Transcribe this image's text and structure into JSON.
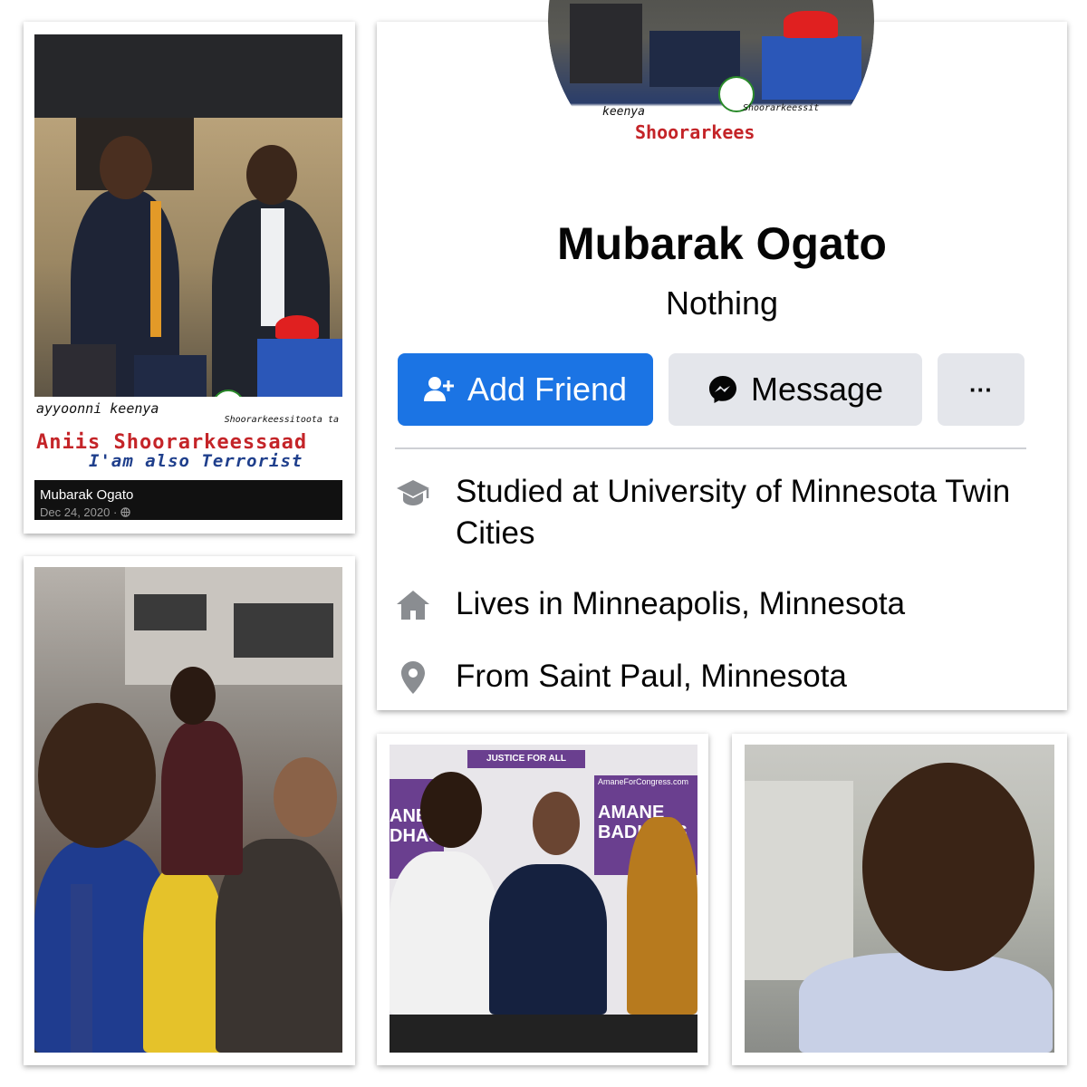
{
  "post": {
    "author_name": "Mubarak Ogato",
    "date": "Dec 24, 2020",
    "visibility_separator": "·",
    "visibility_icon": "globe-icon",
    "banner_line1": "ayyoonni keenya",
    "banner_line1_small": "Shoorarkeessitoota ta",
    "banner_line2": "Aniis Shoorarkeessaad",
    "banner_line3": "I'am also Terrorist"
  },
  "profile": {
    "avatar_text_small": "keenya",
    "avatar_text_small2": "Shoorarkeessit",
    "avatar_text_large": "Shoorarkees",
    "name": "Mubarak Ogato",
    "bio": "Nothing",
    "buttons": {
      "add_friend": "Add Friend",
      "message": "Message",
      "more": "···"
    },
    "info": {
      "studied_prefix": "Studied at ",
      "studied_place": "University of Minnesota Twin Cities",
      "lives_prefix": "Lives in ",
      "lives_place": "Minneapolis, Minnesota",
      "from_prefix": "From ",
      "from_place": "Saint Paul, Minnesota"
    }
  },
  "campaign": {
    "justice_sign": "JUSTICE FOR ALL",
    "site_small": "AmaneForCongress.com",
    "left_sign": "ANE DHAS",
    "right_sign_line1": "AMANE",
    "right_sign_line2": "BADHASS"
  },
  "colors": {
    "facebook_blue": "#1b74e4",
    "button_gray": "#e4e6eb",
    "divider": "#ced0d4",
    "icon_gray": "#65676b",
    "banner_red": "#c42428",
    "banner_blue": "#1f3f8c"
  }
}
